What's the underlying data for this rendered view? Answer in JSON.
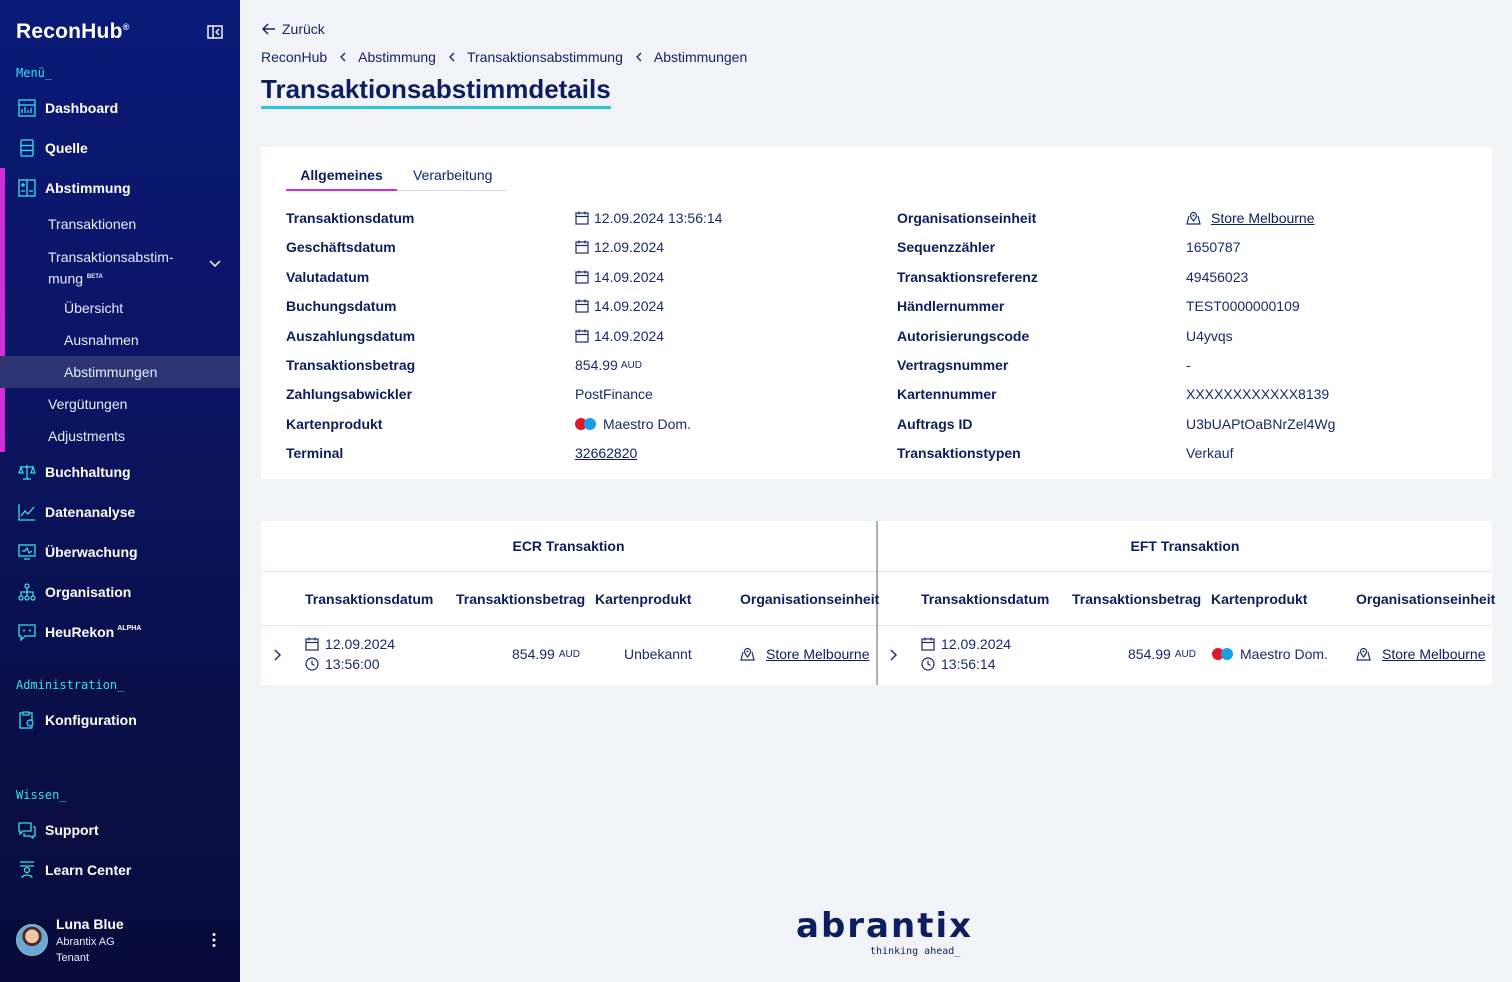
{
  "sidebar": {
    "logo": "ReconHub",
    "logo_mark": "®",
    "menu_label": "Menü_",
    "items": [
      {
        "label": "Dashboard",
        "icon": "dashboard-icon"
      },
      {
        "label": "Quelle",
        "icon": "database-icon"
      },
      {
        "label": "Abstimmung",
        "icon": "reconcile-icon"
      },
      {
        "label": "Buchhaltung",
        "icon": "scale-icon"
      },
      {
        "label": "Datenanalyse",
        "icon": "chart-icon"
      },
      {
        "label": "Überwachung",
        "icon": "monitor-icon"
      },
      {
        "label": "Organisation",
        "icon": "org-icon"
      },
      {
        "label": "HeuRekon",
        "icon": "chat-bot-icon",
        "badge": "ALPHA"
      }
    ],
    "sub_items": {
      "transaktionen": "Transaktionen",
      "transaktionsabstimmung": "Transaktionsabstim-mung",
      "transaktionsabstimmung_badge": "BETA",
      "uebersicht": "Übersicht",
      "ausnahmen": "Ausnahmen",
      "abstimmungen": "Abstimmungen",
      "verguetungen": "Vergütungen",
      "adjustments": "Adjustments"
    },
    "admin_label": "Administration_",
    "konfiguration": "Konfiguration",
    "wissen_label": "Wissen_",
    "support": "Support",
    "learn_center": "Learn Center",
    "user": {
      "name": "Luna Blue",
      "org": "Abrantix AG",
      "role": "Tenant"
    }
  },
  "header": {
    "back": "Zurück",
    "breadcrumb": [
      "ReconHub",
      "Abstimmung",
      "Transaktionsabstimmung",
      "Abstimmungen"
    ],
    "title": "Transaktionsabstimmdetails"
  },
  "tabs": {
    "active": "Allgemeines",
    "inactive": "Verarbeitung"
  },
  "details_left": [
    {
      "label": "Transaktionsdatum",
      "value": "12.09.2024 13:56:14",
      "kind": "date"
    },
    {
      "label": "Geschäftsdatum",
      "value": "12.09.2024",
      "kind": "date"
    },
    {
      "label": "Valutadatum",
      "value": "14.09.2024",
      "kind": "date"
    },
    {
      "label": "Buchungsdatum",
      "value": "14.09.2024",
      "kind": "date"
    },
    {
      "label": "Auszahlungsdatum",
      "value": "14.09.2024",
      "kind": "date"
    },
    {
      "label": "Transaktionsbetrag",
      "value": "854.99",
      "unit": "AUD",
      "kind": "amount"
    },
    {
      "label": "Zahlungsabwickler",
      "value": "PostFinance",
      "kind": "text"
    },
    {
      "label": "Kartenprodukt",
      "value": "Maestro Dom.",
      "kind": "card"
    },
    {
      "label": "Terminal",
      "value": "32662820",
      "kind": "link"
    }
  ],
  "details_right": [
    {
      "label": "Organisationseinheit",
      "value": "Store Melbourne",
      "kind": "location-link"
    },
    {
      "label": "Sequenzzähler",
      "value": "1650787",
      "kind": "text"
    },
    {
      "label": "Transaktionsreferenz",
      "value": "49456023",
      "kind": "text"
    },
    {
      "label": "Händlernummer",
      "value": "TEST0000000109",
      "kind": "text"
    },
    {
      "label": "Autorisierungscode",
      "value": "U4yvqs",
      "kind": "text"
    },
    {
      "label": "Vertragsnummer",
      "value": "-",
      "kind": "text"
    },
    {
      "label": "Kartennummer",
      "value": "XXXXXXXXXXXX8139",
      "kind": "text"
    },
    {
      "label": "Auftrags ID",
      "value": "U3bUAPtOaBNrZel4Wg",
      "kind": "text"
    },
    {
      "label": "Transaktionstypen",
      "value": "Verkauf",
      "kind": "text"
    }
  ],
  "comparison": {
    "ecr": {
      "title": "ECR Transaktion",
      "columns": [
        "Transaktionsdatum",
        "Transaktionsbetrag",
        "Kartenprodukt",
        "Organisationseinheit"
      ],
      "row": {
        "date": "12.09.2024",
        "time": "13:56:00",
        "amount": "854.99",
        "unit": "AUD",
        "card": "Unbekannt",
        "org": "Store Melbourne"
      }
    },
    "eft": {
      "title": "EFT Transaktion",
      "columns": [
        "Transaktionsdatum",
        "Transaktionsbetrag",
        "Kartenprodukt",
        "Organisationseinheit"
      ],
      "row": {
        "date": "12.09.2024",
        "time": "13:56:14",
        "amount": "854.99",
        "unit": "AUD",
        "card": "Maestro Dom.",
        "org": "Store Melbourne"
      }
    }
  },
  "footer": {
    "brand": "abrantix",
    "tagline": "thinking ahead_"
  },
  "colors": {
    "accent": "#d42cd8",
    "title_underline": "#2cc6da",
    "navy": "#0d1e5e",
    "sidebar_top": "#0a1a78"
  }
}
